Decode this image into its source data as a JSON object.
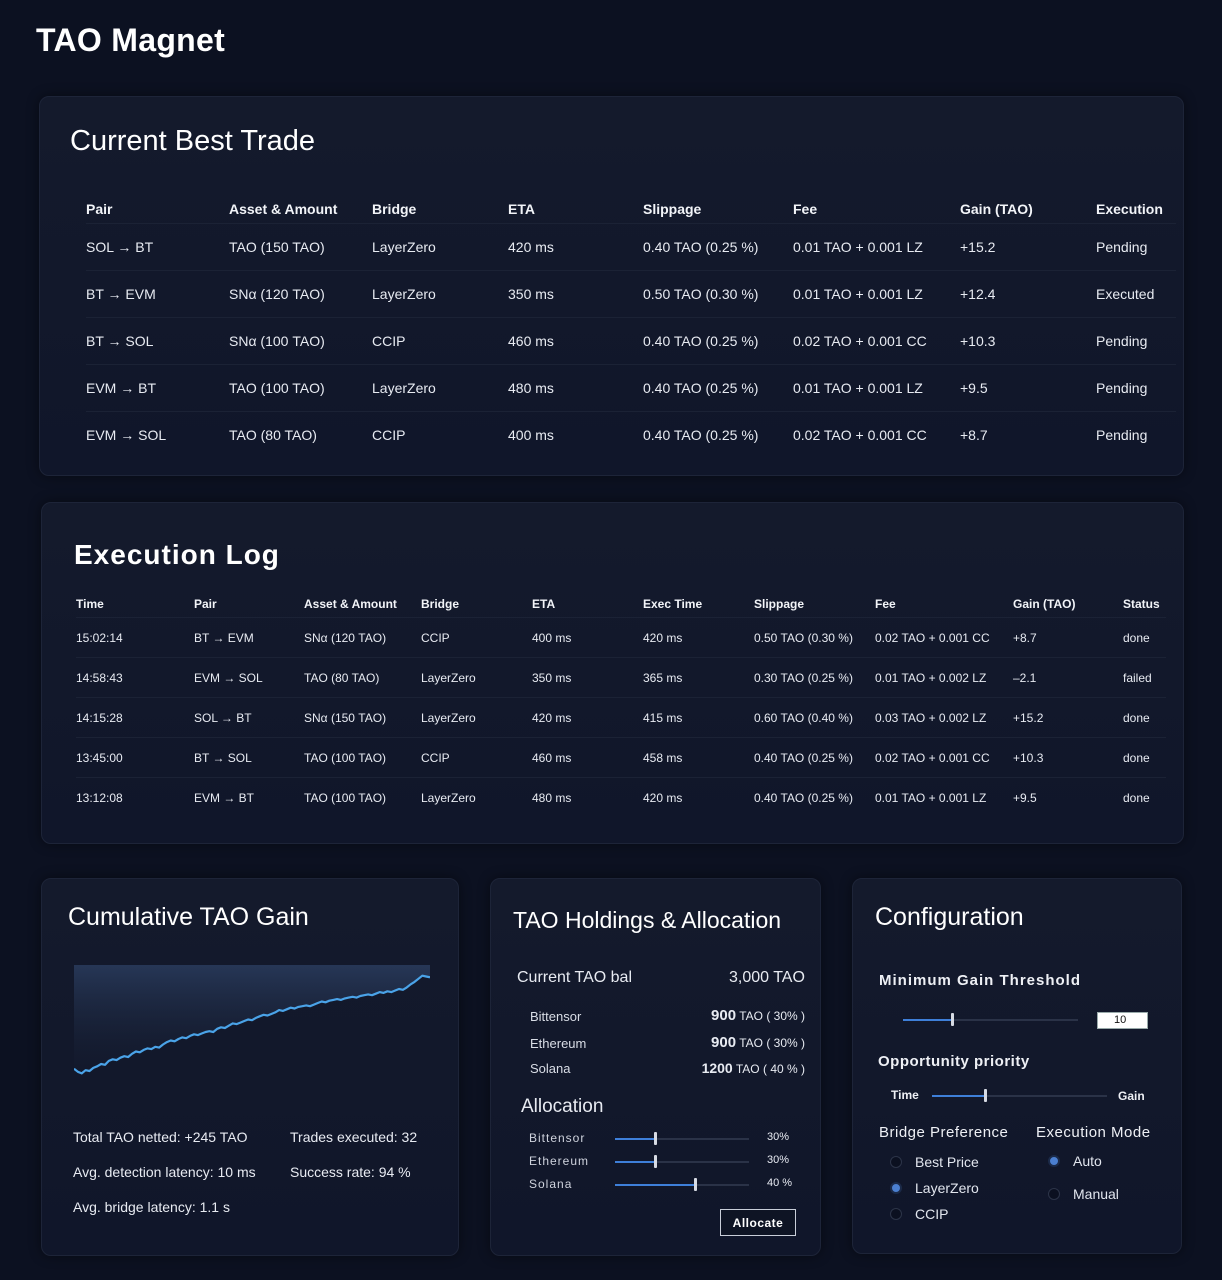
{
  "app": {
    "title": "TAO Magnet"
  },
  "best_trade": {
    "title": "Current Best Trade",
    "columns": [
      "Pair",
      "Asset & Amount",
      "Bridge",
      "ETA",
      "Slippage",
      "Fee",
      "Gain (TAO)",
      "Execution"
    ],
    "rows": [
      [
        "SOL → BT",
        "TAO (150 TAO)",
        "LayerZero",
        "420 ms",
        "0.40 TAO (0.25 %)",
        "0.01 TAO + 0.001 LZ",
        "+15.2",
        "Pending"
      ],
      [
        "BT → EVM",
        "SNα (120 TAO)",
        "LayerZero",
        "350 ms",
        "0.50 TAO (0.30 %)",
        "0.01 TAO + 0.001 LZ",
        "+12.4",
        "Executed"
      ],
      [
        "BT → SOL",
        "SNα (100 TAO)",
        "CCIP",
        "460 ms",
        "0.40 TAO (0.25 %)",
        "0.02 TAO + 0.001 CC",
        "+10.3",
        "Pending"
      ],
      [
        "EVM → BT",
        "TAO (100 TAO)",
        "LayerZero",
        "480 ms",
        "0.40 TAO (0.25 %)",
        "0.01 TAO + 0.001 LZ",
        "+9.5",
        "Pending"
      ],
      [
        "EVM → SOL",
        "TAO (80 TAO)",
        "CCIP",
        "400 ms",
        "0.40 TAO (0.25 %)",
        "0.02 TAO + 0.001 CC",
        "+8.7",
        "Pending"
      ]
    ]
  },
  "exec_log": {
    "title": "Execution Log",
    "columns": [
      "Time",
      "Pair",
      "Asset & Amount",
      "Bridge",
      "ETA",
      "Exec Time",
      "Slippage",
      "Fee",
      "Gain (TAO)",
      "Status"
    ],
    "rows": [
      [
        "15:02:14",
        "BT → EVM",
        "SNα (120 TAO)",
        "CCIP",
        "400 ms",
        "420 ms",
        "0.50 TAO (0.30 %)",
        "0.02 TAO + 0.001 CC",
        "+8.7",
        "done"
      ],
      [
        "14:58:43",
        "EVM → SOL",
        "TAO (80 TAO)",
        "LayerZero",
        "350 ms",
        "365 ms",
        "0.30 TAO (0.25 %)",
        "0.01 TAO + 0.002 LZ",
        "–2.1",
        "failed"
      ],
      [
        "14:15:28",
        "SOL → BT",
        "SNα (150 TAO)",
        "LayerZero",
        "420 ms",
        "415 ms",
        "0.60 TAO (0.40 %)",
        "0.03 TAO + 0.002 LZ",
        "+15.2",
        "done"
      ],
      [
        "13:45:00",
        "BT → SOL",
        "TAO (100 TAO)",
        "CCIP",
        "460 ms",
        "458 ms",
        "0.40 TAO (0.25 %)",
        "0.02 TAO + 0.001 CC",
        "+10.3",
        "done"
      ],
      [
        "13:12:08",
        "EVM → BT",
        "TAO (100 TAO)",
        "LayerZero",
        "480 ms",
        "420 ms",
        "0.40 TAO (0.25 %)",
        "0.01 TAO + 0.001 LZ",
        "+9.5",
        "done"
      ]
    ]
  },
  "gain": {
    "title": "Cumulative TAO Gain",
    "total": "Total TAO netted: +245 TAO",
    "trades": "Trades executed: 32",
    "detect_latency": "Avg. detection latency: 10 ms",
    "success": "Success rate: 94 %",
    "bridge_latency": "Avg. bridge latency: 1.1 s",
    "line_color": "#4aa3e8",
    "series": [
      52,
      48,
      46,
      50,
      49,
      53,
      55,
      58,
      57,
      62,
      64,
      63,
      66,
      68,
      67,
      71,
      74,
      73,
      76,
      78,
      77,
      80,
      79,
      83,
      86,
      88,
      87,
      90,
      92,
      91,
      94,
      96,
      95,
      97,
      99,
      100,
      99,
      103,
      105,
      104,
      107,
      110,
      109,
      111,
      113,
      115,
      114,
      117,
      119,
      121,
      120,
      122,
      124,
      127,
      126,
      128,
      130,
      129,
      131,
      132,
      133,
      132,
      134,
      136,
      138,
      137,
      139,
      140,
      141,
      140,
      142,
      143,
      144,
      143,
      145,
      146,
      147,
      146,
      148,
      150,
      149,
      151,
      150,
      152,
      154,
      153,
      156,
      160,
      163,
      167,
      171,
      170,
      169
    ]
  },
  "holdings": {
    "title": "TAO Holdings & Allocation",
    "balance_label": "Current TAO bal",
    "balance_value": "3,000  TAO",
    "chains": [
      {
        "name": "Bittensor",
        "amount": "900",
        "unit": "TAO",
        "pct": "( 30% )"
      },
      {
        "name": "Ethereum",
        "amount": "900",
        "unit": "TAO",
        "pct": "( 30% )"
      },
      {
        "name": "Solana",
        "amount": "1200",
        "unit": "TAO",
        "pct": "( 40 % )"
      }
    ],
    "allocation_title": "Allocation",
    "allocation": [
      {
        "name": "Bittensor",
        "pct_label": "30%",
        "level": 0.3
      },
      {
        "name": "Ethereum",
        "pct_label": "30%",
        "level": 0.3
      },
      {
        "name": "Solana",
        "pct_label": "40 %",
        "level": 0.6
      }
    ],
    "allocate_button": "Allocate"
  },
  "config": {
    "title": "Configuration",
    "min_gain_label": "Minimum Gain Threshold",
    "min_gain_value": "10",
    "min_gain_level": 0.28,
    "priority_label": "Opportunity priority",
    "priority_left": "Time",
    "priority_right": "Gain",
    "priority_level": 0.3,
    "bridge_pref_label": "Bridge Preference",
    "bridge_options": [
      "Best Price",
      "LayerZero",
      "CCIP"
    ],
    "bridge_selected": "LayerZero",
    "exec_mode_label": "Execution Mode",
    "exec_options": [
      "Auto",
      "Manual"
    ],
    "exec_selected": "Auto",
    "accent": "#4b7fd0"
  }
}
